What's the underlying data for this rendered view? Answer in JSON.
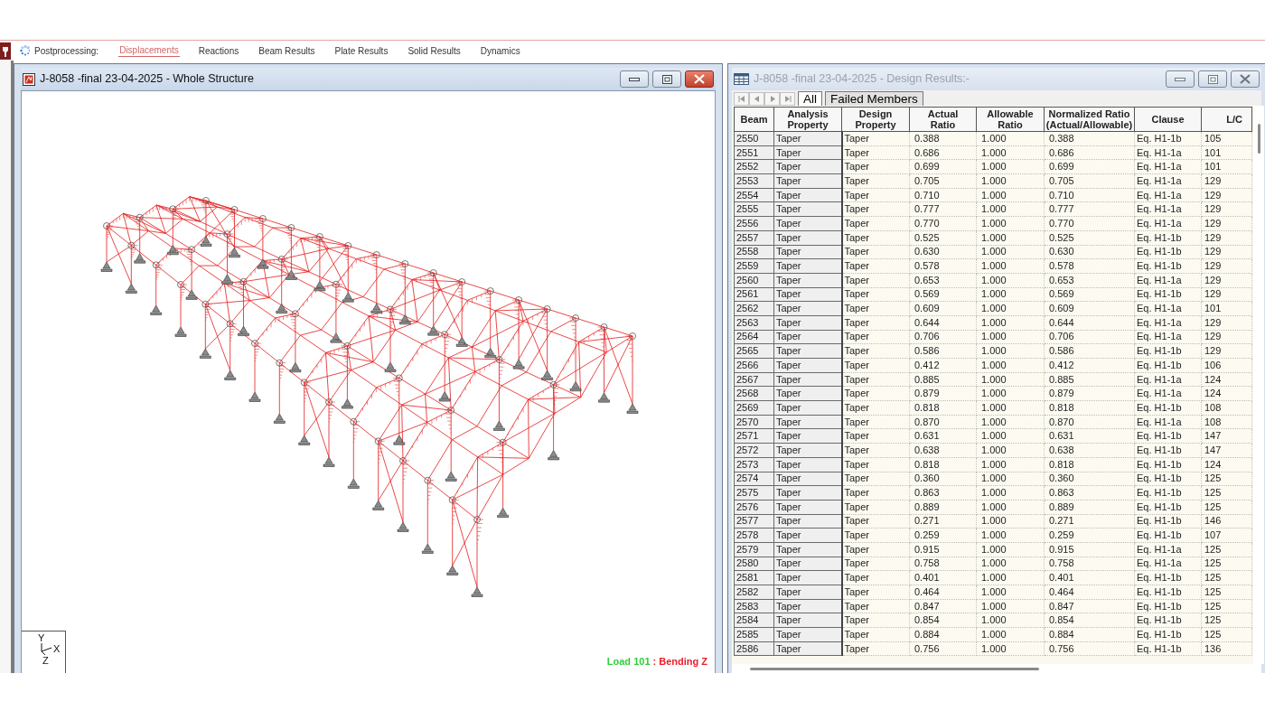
{
  "toolbar": {
    "label": "Postprocessing:",
    "tabs": [
      {
        "label": "Displacements",
        "selected": true
      },
      {
        "label": "Reactions",
        "selected": false
      },
      {
        "label": "Beam Results",
        "selected": false
      },
      {
        "label": "Plate Results",
        "selected": false
      },
      {
        "label": "Solid Results",
        "selected": false
      },
      {
        "label": "Dynamics",
        "selected": false
      }
    ]
  },
  "viewport_window": {
    "title": "J-8058 -final 23-04-2025 - Whole Structure",
    "active": true,
    "axis_labels": {
      "y": "Y",
      "x": "X",
      "z": "Z"
    },
    "caption": {
      "load": "Load 101",
      "result": ": Bending Z"
    }
  },
  "results_window": {
    "title": "J-8058 -final 23-04-2025 - Design Results:-",
    "active": false,
    "tabs": [
      {
        "label": "All",
        "selected": true
      },
      {
        "label": "Failed Members",
        "selected": false
      }
    ],
    "table": {
      "columns": [
        "Beam",
        "Analysis Property",
        "Design Property",
        "Actual Ratio",
        "Allowable Ratio",
        "Normalized Ratio (Actual/Allowable)",
        "Clause",
        "L/C"
      ],
      "rows": [
        [
          "2550",
          "Taper",
          "Taper",
          "0.388",
          "1.000",
          "0.388",
          "Eq. H1-1b",
          "105"
        ],
        [
          "2551",
          "Taper",
          "Taper",
          "0.686",
          "1.000",
          "0.686",
          "Eq. H1-1a",
          "101"
        ],
        [
          "2552",
          "Taper",
          "Taper",
          "0.699",
          "1.000",
          "0.699",
          "Eq. H1-1a",
          "101"
        ],
        [
          "2553",
          "Taper",
          "Taper",
          "0.705",
          "1.000",
          "0.705",
          "Eq. H1-1a",
          "129"
        ],
        [
          "2554",
          "Taper",
          "Taper",
          "0.710",
          "1.000",
          "0.710",
          "Eq. H1-1a",
          "129"
        ],
        [
          "2555",
          "Taper",
          "Taper",
          "0.777",
          "1.000",
          "0.777",
          "Eq. H1-1a",
          "129"
        ],
        [
          "2556",
          "Taper",
          "Taper",
          "0.770",
          "1.000",
          "0.770",
          "Eq. H1-1a",
          "129"
        ],
        [
          "2557",
          "Taper",
          "Taper",
          "0.525",
          "1.000",
          "0.525",
          "Eq. H1-1b",
          "129"
        ],
        [
          "2558",
          "Taper",
          "Taper",
          "0.630",
          "1.000",
          "0.630",
          "Eq. H1-1b",
          "129"
        ],
        [
          "2559",
          "Taper",
          "Taper",
          "0.578",
          "1.000",
          "0.578",
          "Eq. H1-1b",
          "129"
        ],
        [
          "2560",
          "Taper",
          "Taper",
          "0.653",
          "1.000",
          "0.653",
          "Eq. H1-1a",
          "129"
        ],
        [
          "2561",
          "Taper",
          "Taper",
          "0.569",
          "1.000",
          "0.569",
          "Eq. H1-1b",
          "129"
        ],
        [
          "2562",
          "Taper",
          "Taper",
          "0.609",
          "1.000",
          "0.609",
          "Eq. H1-1a",
          "101"
        ],
        [
          "2563",
          "Taper",
          "Taper",
          "0.644",
          "1.000",
          "0.644",
          "Eq. H1-1a",
          "129"
        ],
        [
          "2564",
          "Taper",
          "Taper",
          "0.706",
          "1.000",
          "0.706",
          "Eq. H1-1a",
          "129"
        ],
        [
          "2565",
          "Taper",
          "Taper",
          "0.586",
          "1.000",
          "0.586",
          "Eq. H1-1b",
          "129"
        ],
        [
          "2566",
          "Taper",
          "Taper",
          "0.412",
          "1.000",
          "0.412",
          "Eq. H1-1b",
          "106"
        ],
        [
          "2567",
          "Taper",
          "Taper",
          "0.885",
          "1.000",
          "0.885",
          "Eq. H1-1a",
          "124"
        ],
        [
          "2568",
          "Taper",
          "Taper",
          "0.879",
          "1.000",
          "0.879",
          "Eq. H1-1a",
          "124"
        ],
        [
          "2569",
          "Taper",
          "Taper",
          "0.818",
          "1.000",
          "0.818",
          "Eq. H1-1b",
          "108"
        ],
        [
          "2570",
          "Taper",
          "Taper",
          "0.870",
          "1.000",
          "0.870",
          "Eq. H1-1a",
          "108"
        ],
        [
          "2571",
          "Taper",
          "Taper",
          "0.631",
          "1.000",
          "0.631",
          "Eq. H1-1b",
          "147"
        ],
        [
          "2572",
          "Taper",
          "Taper",
          "0.638",
          "1.000",
          "0.638",
          "Eq. H1-1b",
          "147"
        ],
        [
          "2573",
          "Taper",
          "Taper",
          "0.818",
          "1.000",
          "0.818",
          "Eq. H1-1b",
          "124"
        ],
        [
          "2574",
          "Taper",
          "Taper",
          "0.360",
          "1.000",
          "0.360",
          "Eq. H1-1b",
          "125"
        ],
        [
          "2575",
          "Taper",
          "Taper",
          "0.863",
          "1.000",
          "0.863",
          "Eq. H1-1b",
          "125"
        ],
        [
          "2576",
          "Taper",
          "Taper",
          "0.889",
          "1.000",
          "0.889",
          "Eq. H1-1b",
          "125"
        ],
        [
          "2577",
          "Taper",
          "Taper",
          "0.271",
          "1.000",
          "0.271",
          "Eq. H1-1b",
          "146"
        ],
        [
          "2578",
          "Taper",
          "Taper",
          "0.259",
          "1.000",
          "0.259",
          "Eq. H1-1b",
          "107"
        ],
        [
          "2579",
          "Taper",
          "Taper",
          "0.915",
          "1.000",
          "0.915",
          "Eq. H1-1a",
          "125"
        ],
        [
          "2580",
          "Taper",
          "Taper",
          "0.758",
          "1.000",
          "0.758",
          "Eq. H1-1a",
          "125"
        ],
        [
          "2581",
          "Taper",
          "Taper",
          "0.401",
          "1.000",
          "0.401",
          "Eq. H1-1b",
          "125"
        ],
        [
          "2582",
          "Taper",
          "Taper",
          "0.464",
          "1.000",
          "0.464",
          "Eq. H1-1b",
          "125"
        ],
        [
          "2583",
          "Taper",
          "Taper",
          "0.847",
          "1.000",
          "0.847",
          "Eq. H1-1b",
          "125"
        ],
        [
          "2584",
          "Taper",
          "Taper",
          "0.854",
          "1.000",
          "0.854",
          "Eq. H1-1b",
          "125"
        ],
        [
          "2585",
          "Taper",
          "Taper",
          "0.884",
          "1.000",
          "0.884",
          "Eq. H1-1b",
          "125"
        ],
        [
          "2586",
          "Taper",
          "Taper",
          "0.756",
          "1.000",
          "0.756",
          "Eq. H1-1b",
          "136"
        ]
      ]
    }
  }
}
